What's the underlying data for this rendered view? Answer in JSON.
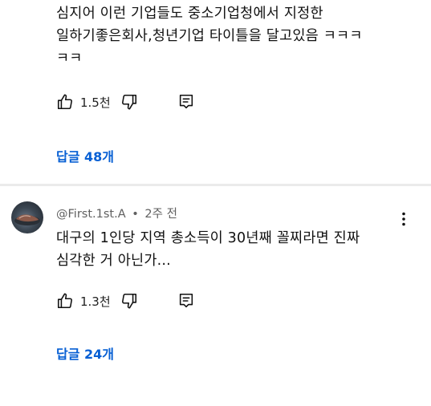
{
  "comment1": {
    "text_line1": "심지어 이런 기업들도 중소기업청에서 지정한",
    "text_line2": "일하기좋은회사,청년기업 타이틀을 달고있음 ㅋㅋㅋ",
    "text_line3": "ㅋㅋ",
    "likes": "1.5천",
    "replies_label": "답글 48개"
  },
  "comment2": {
    "author": "@First.1st.A",
    "time": "2주 전",
    "separator": "•",
    "text_line1": "대구의 1인당 지역 총소득이 30년째 꼴찌라면 진짜",
    "text_line2": "심각한 거 아닌가...",
    "likes": "1.3천",
    "replies_label": "답글 24개"
  },
  "icons": {
    "like": "thumbs-up-icon",
    "dislike": "thumbs-down-icon",
    "reply": "comment-reply-icon",
    "more": "more-vertical-icon"
  },
  "colors": {
    "link": "#065fd4",
    "meta": "#606060",
    "text": "#0f0f0f",
    "divider": "#ebebeb"
  }
}
